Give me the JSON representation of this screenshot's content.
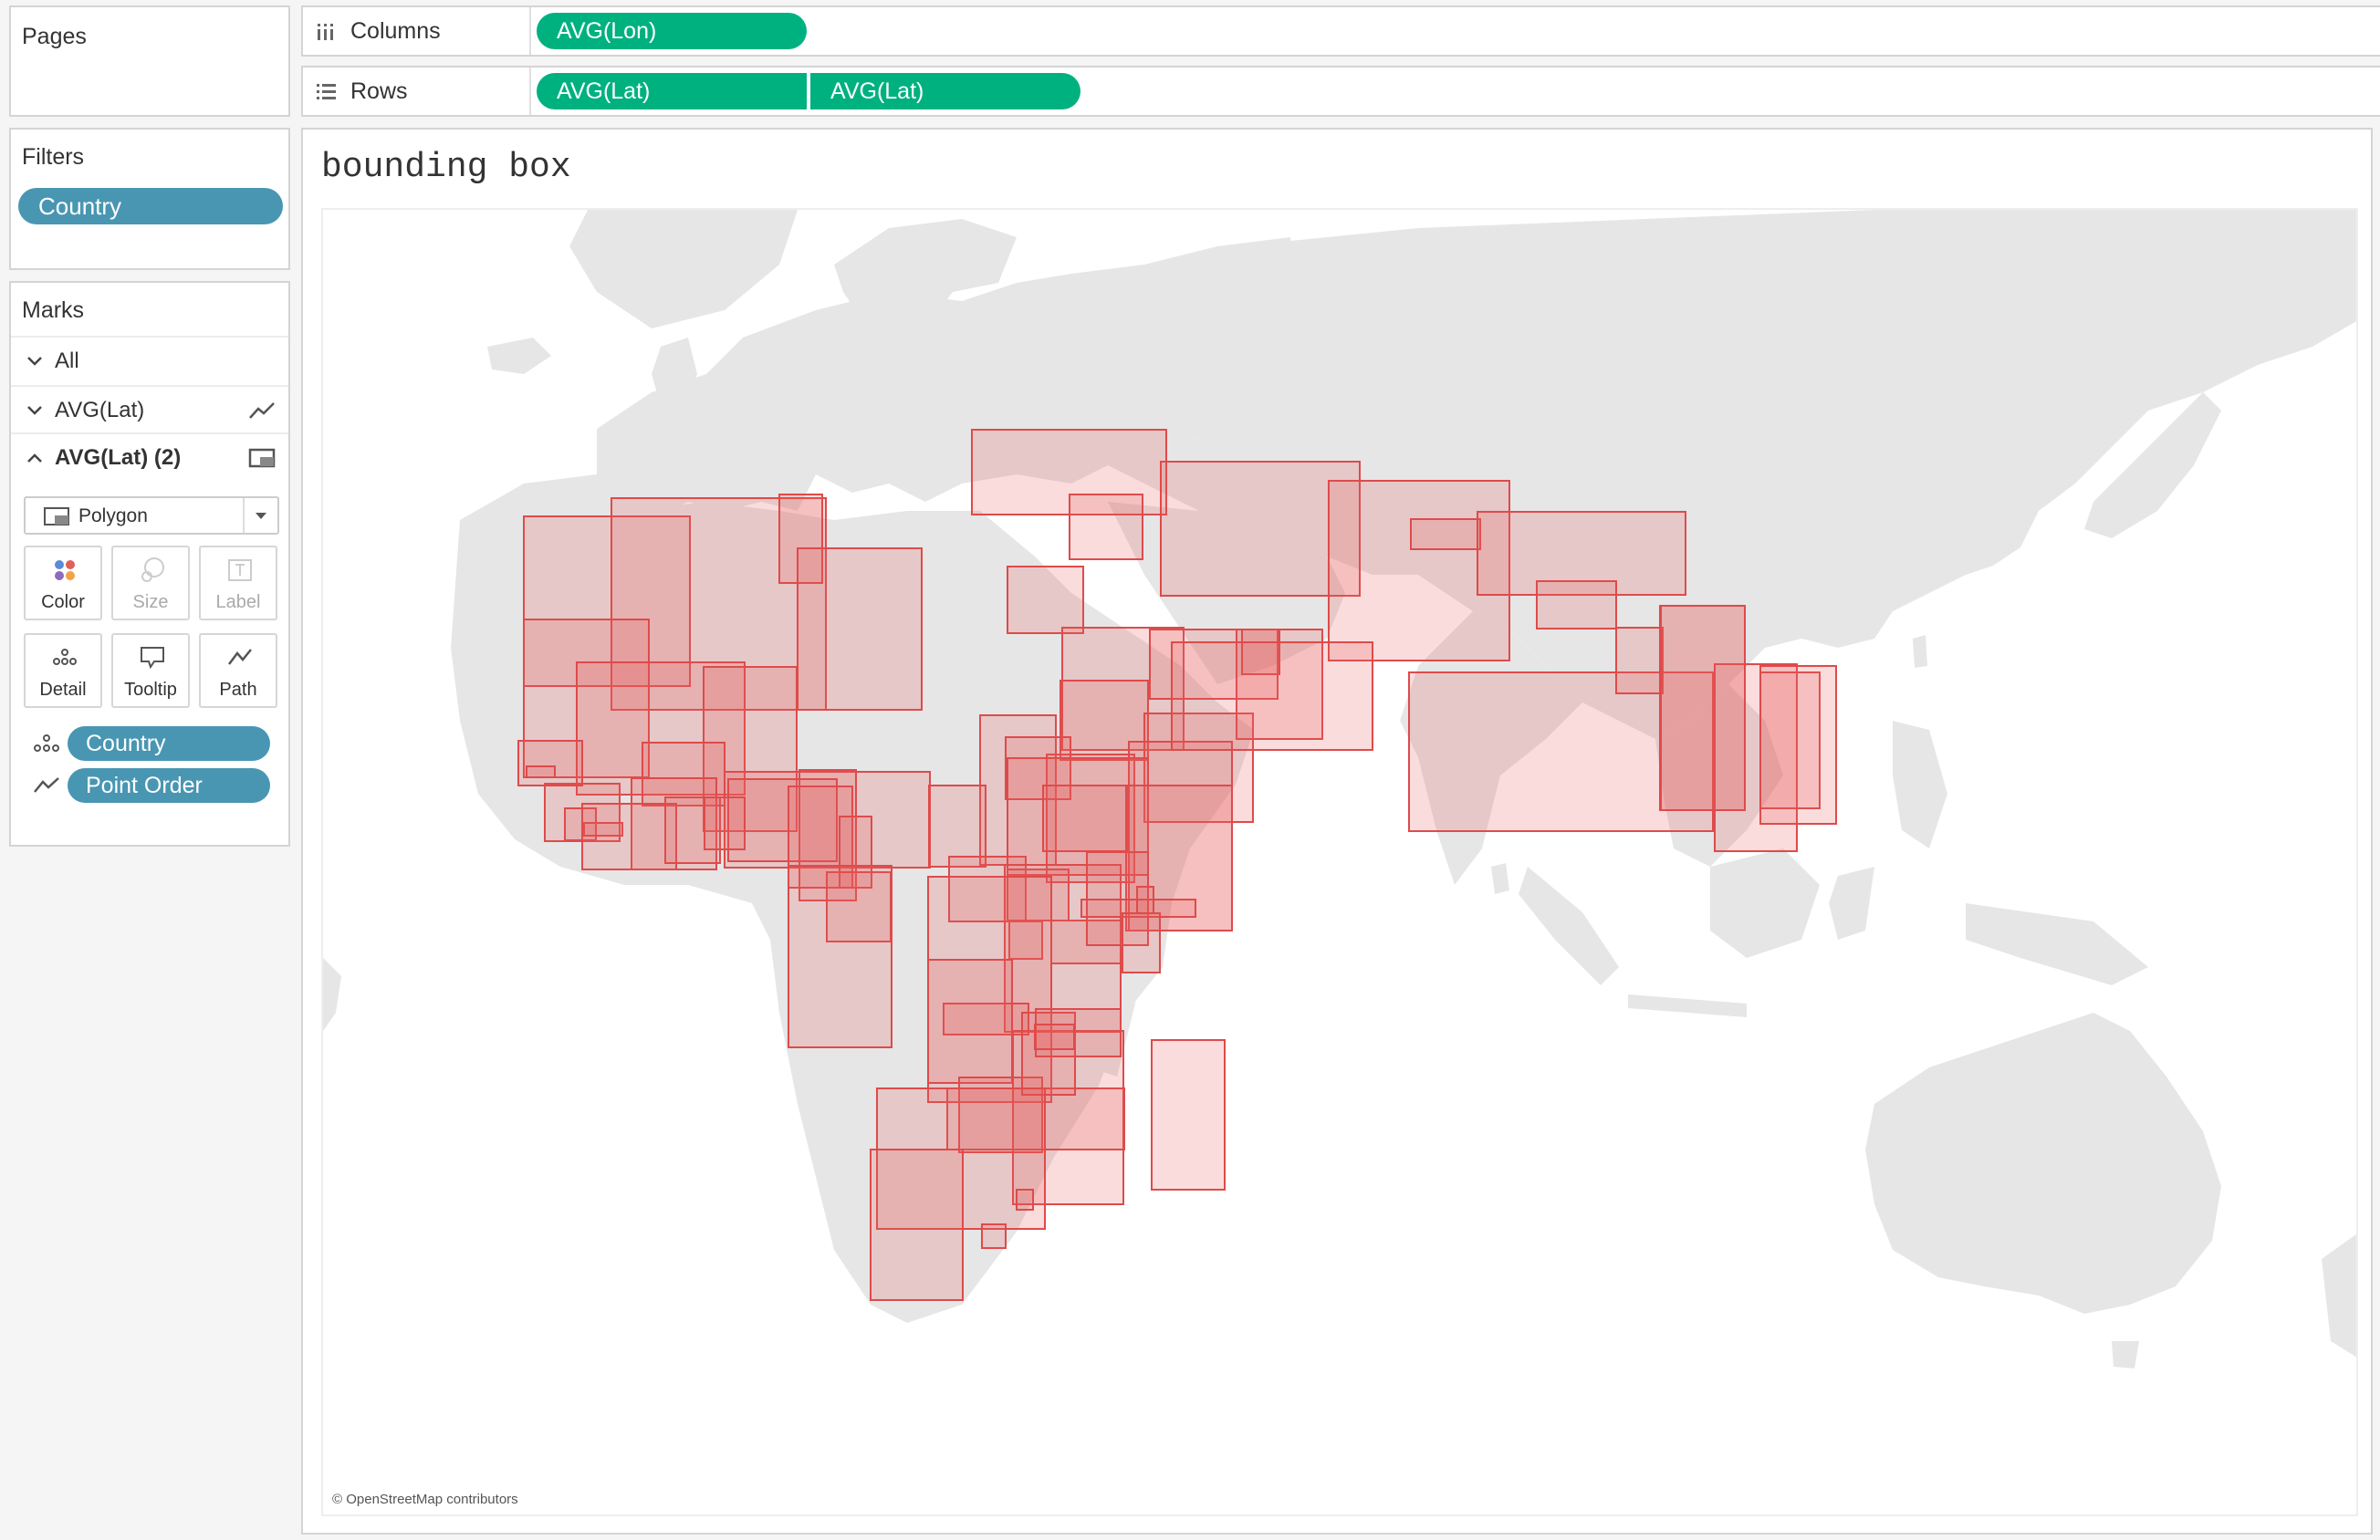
{
  "pages": {
    "title": "Pages"
  },
  "columns_shelf": {
    "label": "Columns",
    "pills": [
      "AVG(Lon)"
    ]
  },
  "rows_shelf": {
    "label": "Rows",
    "pills": [
      "AVG(Lat)",
      "AVG(Lat)"
    ]
  },
  "filters": {
    "title": "Filters",
    "pills": [
      "Country"
    ]
  },
  "marks": {
    "title": "Marks",
    "cards": [
      {
        "label": "All",
        "expanded": false
      },
      {
        "label": "AVG(Lat)",
        "expanded": false,
        "icon": "line-icon"
      },
      {
        "label": "AVG(Lat) (2)",
        "expanded": true,
        "icon": "polygon-icon"
      }
    ],
    "mark_type": "Polygon",
    "buttons": {
      "color": "Color",
      "size": "Size",
      "label": "Label",
      "detail": "Detail",
      "tooltip": "Tooltip",
      "path": "Path"
    },
    "fields": [
      {
        "label": "Country",
        "icon": "detail-icon"
      },
      {
        "label": "Point Order",
        "icon": "path-icon"
      }
    ]
  },
  "view": {
    "title": "bounding box",
    "attribution": "© OpenStreetMap contributors"
  },
  "colors": {
    "green_pill": "#00b180",
    "blue_pill": "#4996b2",
    "box_fill": "rgba(232,94,94,0.22)",
    "box_stroke": "#de4b4b"
  }
}
